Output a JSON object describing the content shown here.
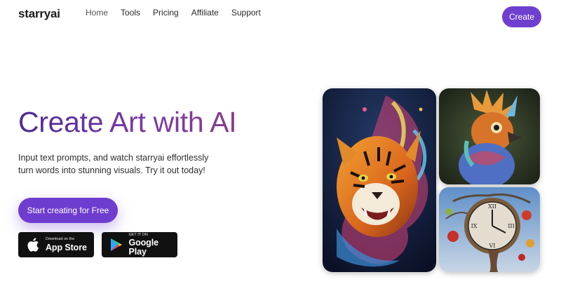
{
  "header": {
    "logo": "starryai",
    "nav": [
      {
        "label": "Home",
        "active": true
      },
      {
        "label": "Tools"
      },
      {
        "label": "Pricing"
      },
      {
        "label": "Affiliate"
      },
      {
        "label": "Support"
      }
    ],
    "create_label": "Create"
  },
  "hero": {
    "title": "Create Art with AI",
    "subtitle": "Input text prompts, and watch starryai effortlessly turn words into stunning visuals. Try it out today!",
    "cta_label": "Start creating for Free"
  },
  "stores": {
    "apple": {
      "small": "Download on the",
      "big": "App Store"
    },
    "google": {
      "small": "GET IT ON",
      "big": "Google Play"
    }
  },
  "gallery": [
    {
      "name": "tiger-artwork",
      "icon": "tiger-image"
    },
    {
      "name": "bird-artwork",
      "icon": "bird-image"
    },
    {
      "name": "clock-artwork",
      "icon": "clock-image"
    }
  ],
  "colors": {
    "accent": "#6e3dcf",
    "title_gradient_start": "#4b2a96",
    "title_gradient_end": "#8a3c8e",
    "store_button": "#111111"
  }
}
